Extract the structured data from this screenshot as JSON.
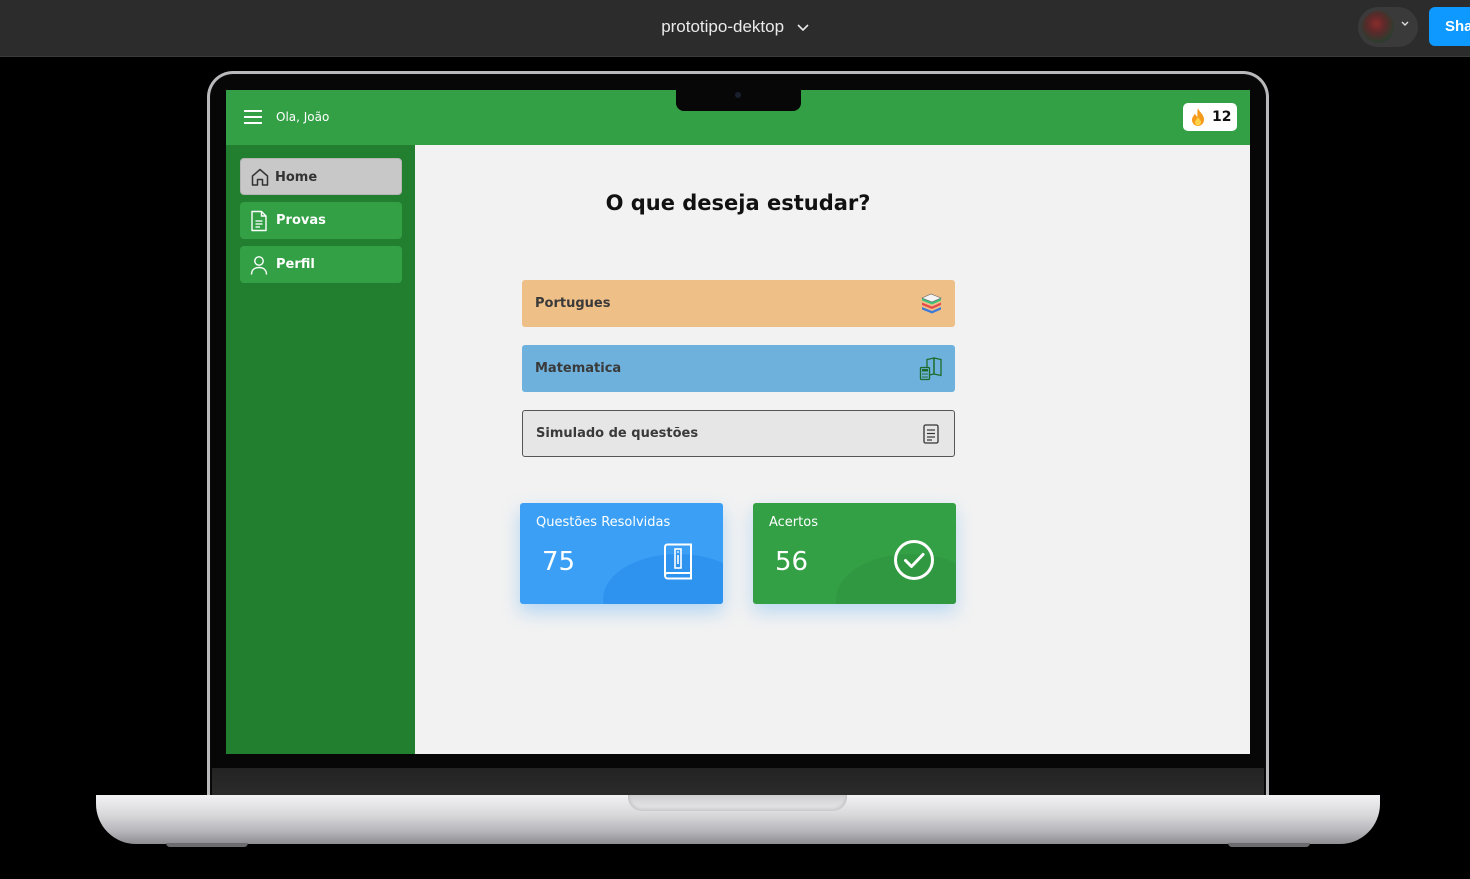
{
  "figma": {
    "file_title": "prototipo-dektop",
    "share_label": "Sha"
  },
  "app": {
    "greeting": "Ola, João",
    "streak_count": "12",
    "nav": [
      {
        "label": "Home",
        "icon": "home-icon",
        "active": true
      },
      {
        "label": "Provas",
        "icon": "document-icon",
        "active": false
      },
      {
        "label": "Perfil",
        "icon": "user-icon",
        "active": false
      }
    ],
    "title": "O que deseja estudar?",
    "subjects": [
      {
        "label": "Portugues",
        "icon": "books-icon",
        "color": "#efbf88"
      },
      {
        "label": "Matematica",
        "icon": "calculator-book-icon",
        "color": "#6db1dc"
      },
      {
        "label": "Simulado de questões",
        "icon": "notepad-icon",
        "color": "#e6e6e6"
      }
    ],
    "stats": [
      {
        "title": "Questões Resolvidas",
        "value": "75",
        "icon": "info-book-icon",
        "color": "#3ba0f5"
      },
      {
        "title": "Acertos",
        "value": "56",
        "icon": "check-circle-icon",
        "color": "#34a046"
      }
    ]
  },
  "colors": {
    "header_green": "#34a046",
    "sidebar_green": "#237f30",
    "figma_blue": "#0d99ff"
  }
}
